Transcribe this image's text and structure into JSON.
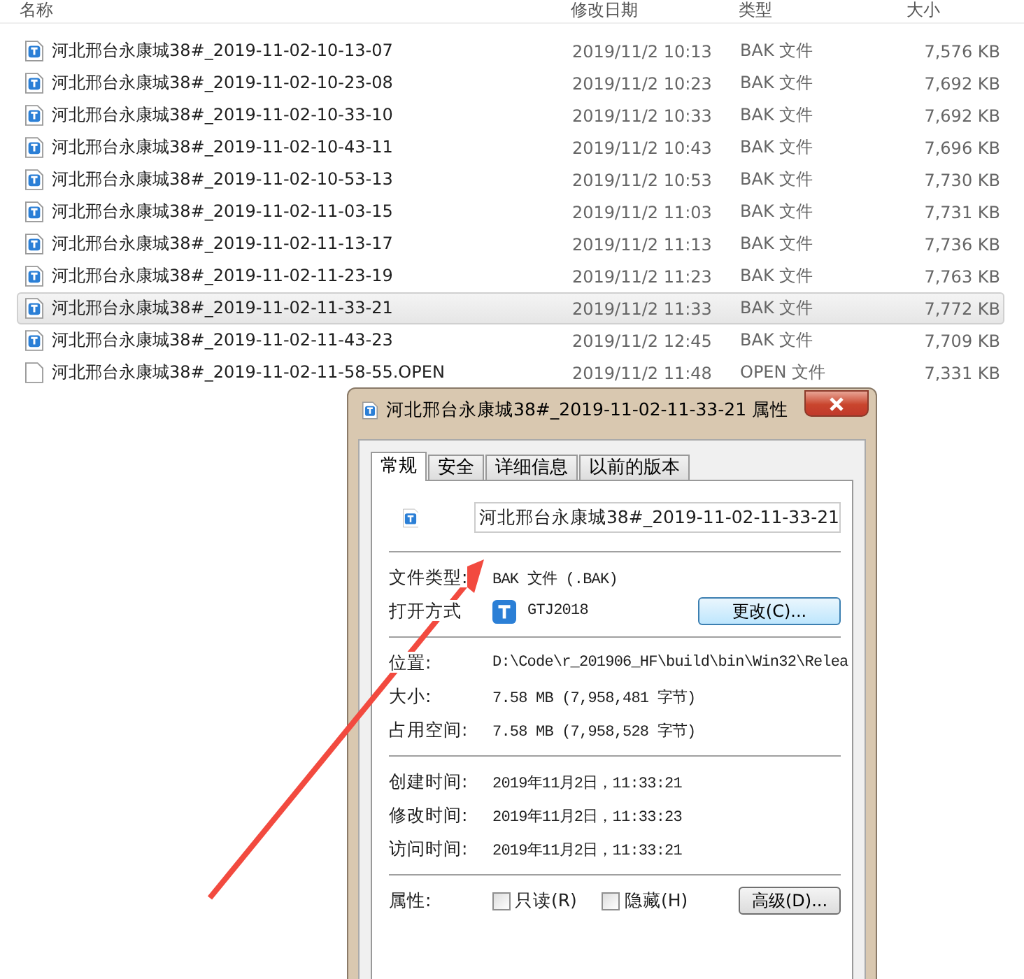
{
  "file_list": {
    "columns": [
      "名称",
      "修改日期",
      "类型",
      "大小"
    ],
    "rows": [
      {
        "name": "河北邢台永康城38#_2019-11-02-10-13-07",
        "date": "2019/11/2 10:13",
        "type": "BAK 文件",
        "size": "7,576 KB",
        "kind": "app",
        "selected": false
      },
      {
        "name": "河北邢台永康城38#_2019-11-02-10-23-08",
        "date": "2019/11/2 10:23",
        "type": "BAK 文件",
        "size": "7,692 KB",
        "kind": "app",
        "selected": false
      },
      {
        "name": "河北邢台永康城38#_2019-11-02-10-33-10",
        "date": "2019/11/2 10:33",
        "type": "BAK 文件",
        "size": "7,692 KB",
        "kind": "app",
        "selected": false
      },
      {
        "name": "河北邢台永康城38#_2019-11-02-10-43-11",
        "date": "2019/11/2 10:43",
        "type": "BAK 文件",
        "size": "7,696 KB",
        "kind": "app",
        "selected": false
      },
      {
        "name": "河北邢台永康城38#_2019-11-02-10-53-13",
        "date": "2019/11/2 10:53",
        "type": "BAK 文件",
        "size": "7,730 KB",
        "kind": "app",
        "selected": false
      },
      {
        "name": "河北邢台永康城38#_2019-11-02-11-03-15",
        "date": "2019/11/2 11:03",
        "type": "BAK 文件",
        "size": "7,731 KB",
        "kind": "app",
        "selected": false
      },
      {
        "name": "河北邢台永康城38#_2019-11-02-11-13-17",
        "date": "2019/11/2 11:13",
        "type": "BAK 文件",
        "size": "7,736 KB",
        "kind": "app",
        "selected": false
      },
      {
        "name": "河北邢台永康城38#_2019-11-02-11-23-19",
        "date": "2019/11/2 11:23",
        "type": "BAK 文件",
        "size": "7,763 KB",
        "kind": "app",
        "selected": false
      },
      {
        "name": "河北邢台永康城38#_2019-11-02-11-33-21",
        "date": "2019/11/2 11:33",
        "type": "BAK 文件",
        "size": "7,772 KB",
        "kind": "app",
        "selected": true
      },
      {
        "name": "河北邢台永康城38#_2019-11-02-11-43-23",
        "date": "2019/11/2 12:45",
        "type": "BAK 文件",
        "size": "7,709 KB",
        "kind": "app",
        "selected": false
      },
      {
        "name": "河北邢台永康城38#_2019-11-02-11-58-55.OPEN",
        "date": "2019/11/2 11:48",
        "type": "OPEN 文件",
        "size": "7,331 KB",
        "kind": "blank",
        "selected": false
      }
    ]
  },
  "dialog": {
    "title": "河北邢台永康城38#_2019-11-02-11-33-21 属性",
    "tabs": [
      {
        "label": "常规",
        "selected": true
      },
      {
        "label": "安全",
        "selected": false
      },
      {
        "label": "详细信息",
        "selected": false
      },
      {
        "label": "以前的版本",
        "selected": false
      }
    ],
    "file_name": "河北邢台永康城38#_2019-11-02-11-33-21",
    "sections": [
      [
        {
          "label": "文件类型:",
          "value": "BAK 文件 (.BAK)"
        },
        {
          "label": "打开方式",
          "value": "GTJ2018",
          "kind": "app",
          "button": "更改(C)..."
        }
      ],
      [
        {
          "label": "位置:",
          "value": "D:\\Code\\r_201906_HF\\build\\bin\\Win32\\Relea"
        },
        {
          "label": "大小:",
          "value": "7.58 MB (7,958,481 字节)"
        },
        {
          "label": "占用空间:",
          "value": "7.58 MB (7,958,528 字节)"
        }
      ],
      [
        {
          "label": "创建时间:",
          "value": "2019年11月2日，11:33:21"
        },
        {
          "label": "修改时间:",
          "value": "2019年11月2日，11:33:23"
        },
        {
          "label": "访问时间:",
          "value": "2019年11月2日，11:33:21"
        }
      ]
    ],
    "attributes": {
      "label": "属性:",
      "checkboxes": [
        {
          "label": "只读(R)",
          "checked": false
        },
        {
          "label": "隐藏(H)",
          "checked": false
        }
      ],
      "button": "高级(D)..."
    }
  }
}
